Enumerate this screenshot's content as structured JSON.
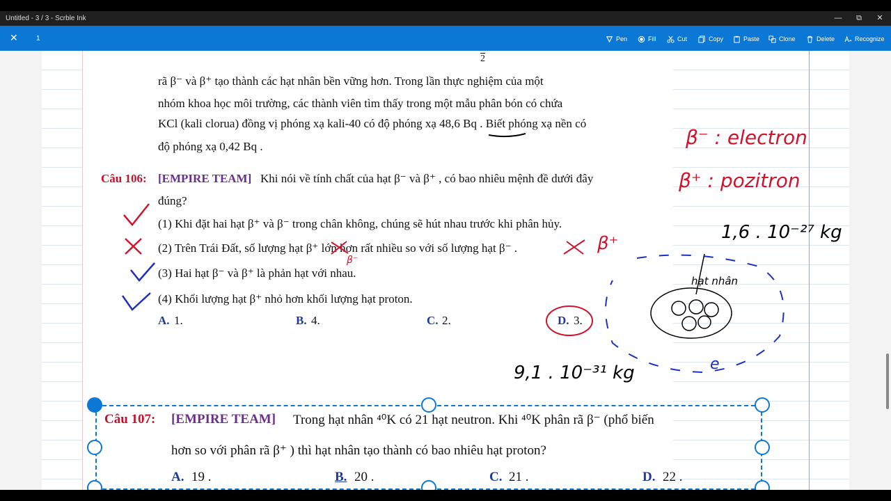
{
  "window": {
    "title": "Untitled - 3 / 3 - Scrble Ink",
    "minimize": "—",
    "maximize": "⧉",
    "close": "✕"
  },
  "toolbar": {
    "close": "✕",
    "page_number": "1",
    "tools": [
      {
        "label": "Pen",
        "icon": "pen-icon"
      },
      {
        "label": "Fill",
        "icon": "fill-icon"
      },
      {
        "label": "Cut",
        "icon": "scissors-icon"
      },
      {
        "label": "Copy",
        "icon": "copy-icon"
      },
      {
        "label": "Paste",
        "icon": "paste-icon"
      },
      {
        "label": "Clone",
        "icon": "clone-icon"
      },
      {
        "label": "Delete",
        "icon": "trash-icon"
      },
      {
        "label": "Recognize",
        "icon": "recognize-icon"
      }
    ],
    "accent": "#0a78d4"
  },
  "document": {
    "top_fragment": "2",
    "para": {
      "line1": "rã β⁻ và β⁺ tạo thành các hạt nhân bền vững hơn. Trong lần thực nghiệm của một",
      "line2": "nhóm khoa học môi trường, các thành viên tìm thấy trong một mẫu phân bón có chứa",
      "line3": "KCl (kali clorua) đồng vị phóng xạ kali-40 có độ phóng xạ  48,6 Bq . Biết phóng xạ nền có",
      "line4": "độ phóng xạ  0,42 Bq ."
    },
    "q106": {
      "label": "Câu 106:",
      "team": "[EMPIRE TEAM]",
      "text1": "Khi nói về tính chất của hạt  β⁻  và  β⁺ , có bao nhiêu mệnh đề dưới đây",
      "text2": "đúng?",
      "statements": [
        "(1) Khi đặt hai hạt  β⁺  và  β⁻  trong chân không, chúng sẽ hút nhau trước khi phân hủy.",
        "(2) Trên Trái Đất, số lượng hạt  β⁺  lớn hơn rất nhiều so với số lượng hạt  β⁻ .",
        "(3) Hai hạt  β⁻  và  β⁺  là phản hạt với nhau.",
        "(4) Khối lượng hạt  β⁺  nhỏ hơn khối lượng hạt proton."
      ],
      "options": [
        {
          "letter": "A.",
          "value": "1."
        },
        {
          "letter": "B.",
          "value": "4."
        },
        {
          "letter": "C.",
          "value": "2."
        },
        {
          "letter": "D.",
          "value": "3."
        }
      ]
    },
    "q107": {
      "label": "Câu 107:",
      "team": "[EMPIRE TEAM]",
      "text1": "Trong hạt nhân  ⁴⁰K  có  21  hạt neutron. Khi  ⁴⁰K  phân rã  β⁻  (phổ biến",
      "text2": "hơn so với phân rã  β⁺ ) thì hạt nhân tạo thành có bao nhiêu hạt proton?",
      "options": [
        {
          "letter": "A.",
          "value": "19 ."
        },
        {
          "letter": "B.",
          "value": "20 ."
        },
        {
          "letter": "C.",
          "value": "21 ."
        },
        {
          "letter": "D.",
          "value": "22 ."
        }
      ]
    }
  },
  "handwriting": {
    "beta_minus": "β⁻ : electron",
    "beta_plus": "β⁺ : pozitron",
    "mass_proton": "1,6 . 10⁻²⁷ kg",
    "mass_electron": "9,1 . 10⁻³¹ kg",
    "nucleus_label": "hạt nhân",
    "electron_label": "e",
    "beta_plus_note": "β⁺",
    "beta_minus_note": "β⁻"
  }
}
